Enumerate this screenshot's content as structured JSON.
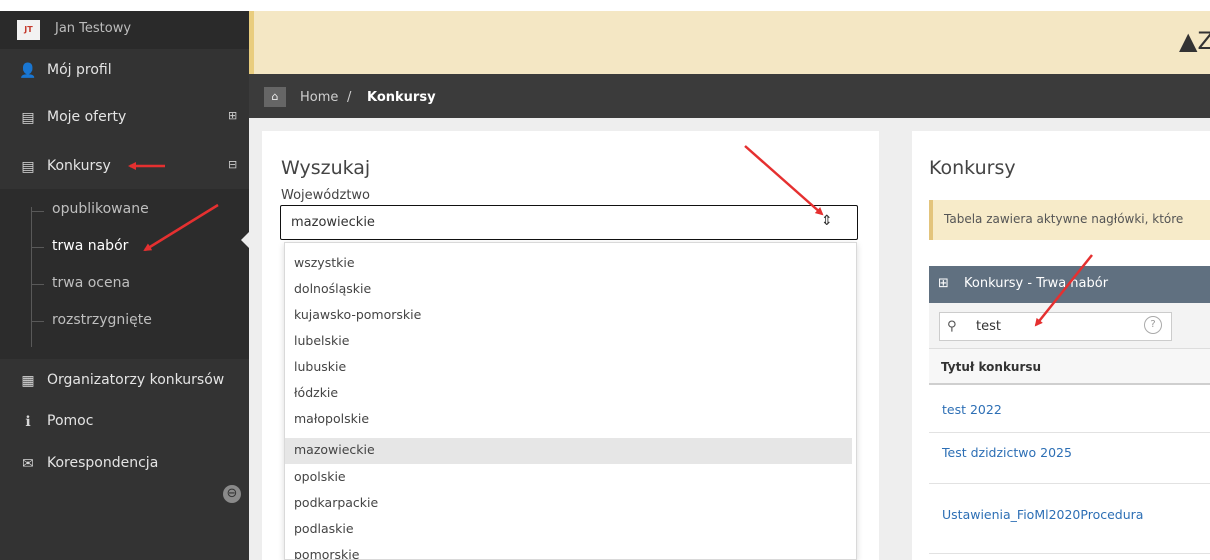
{
  "colors": {
    "sidebar_bg": "#333333",
    "alert_bg": "#f4e7c4",
    "breadcrumb_bg": "#3b3b3b",
    "table_header_bg": "#607080",
    "link": "#2d6fb5",
    "annotation_arrow": "#e53030"
  },
  "user": {
    "initials": "JT",
    "name": "Jan Testowy"
  },
  "sidebar": {
    "items": [
      {
        "label": "Mój profil",
        "icon": "user-icon",
        "glyph": "👤"
      },
      {
        "label": "Moje oferty",
        "icon": "book-icon",
        "glyph": "▤",
        "toggle": "⊞"
      },
      {
        "label": "Konkursy",
        "icon": "book-icon",
        "glyph": "▤",
        "toggle": "⊟"
      }
    ],
    "submenu": [
      "opublikowane",
      "trwa nabór",
      "trwa ocena",
      "rozstrzygnięte"
    ],
    "items_after": [
      {
        "label": "Organizatorzy konkursów",
        "icon": "building-icon",
        "glyph": "▦"
      },
      {
        "label": "Pomoc",
        "icon": "info-icon",
        "glyph": "ℹ"
      },
      {
        "label": "Korespondencja",
        "icon": "envelope-icon",
        "glyph": "✉"
      }
    ],
    "collapse_glyph": "⊖"
  },
  "alert": {
    "text": "▲Z"
  },
  "breadcrumb": {
    "home_glyph": "⌂",
    "home": "Home",
    "sep": "/",
    "current": "Konkursy"
  },
  "search": {
    "title": "Wyszukaj",
    "voivodeship_label": "Województwo",
    "voivodeship_value": "mazowieckie",
    "select_glyph": "⇕",
    "options": [
      "wszystkie",
      "dolnośląskie",
      "kujawsko-pomorskie",
      "lubelskie",
      "lubuskie",
      "łódzkie",
      "małopolskie",
      "mazowieckie",
      "opolskie",
      "podkarpackie",
      "podlaskie",
      "pomorskie"
    ],
    "selected_index": 7
  },
  "results": {
    "title": "Konkursy",
    "info": "Tabela zawiera aktywne nagłówki, które",
    "table_title": "Konkursy - Trwa nabór",
    "table_icon": "⊞",
    "filter_value": "test",
    "search_glyph": "⚲",
    "help_glyph": "?",
    "column": "Tytuł konkursu",
    "rows": [
      "test 2022",
      "Test dzidzictwo 2025",
      "Ustawienia_FioMl2020Procedura"
    ]
  }
}
